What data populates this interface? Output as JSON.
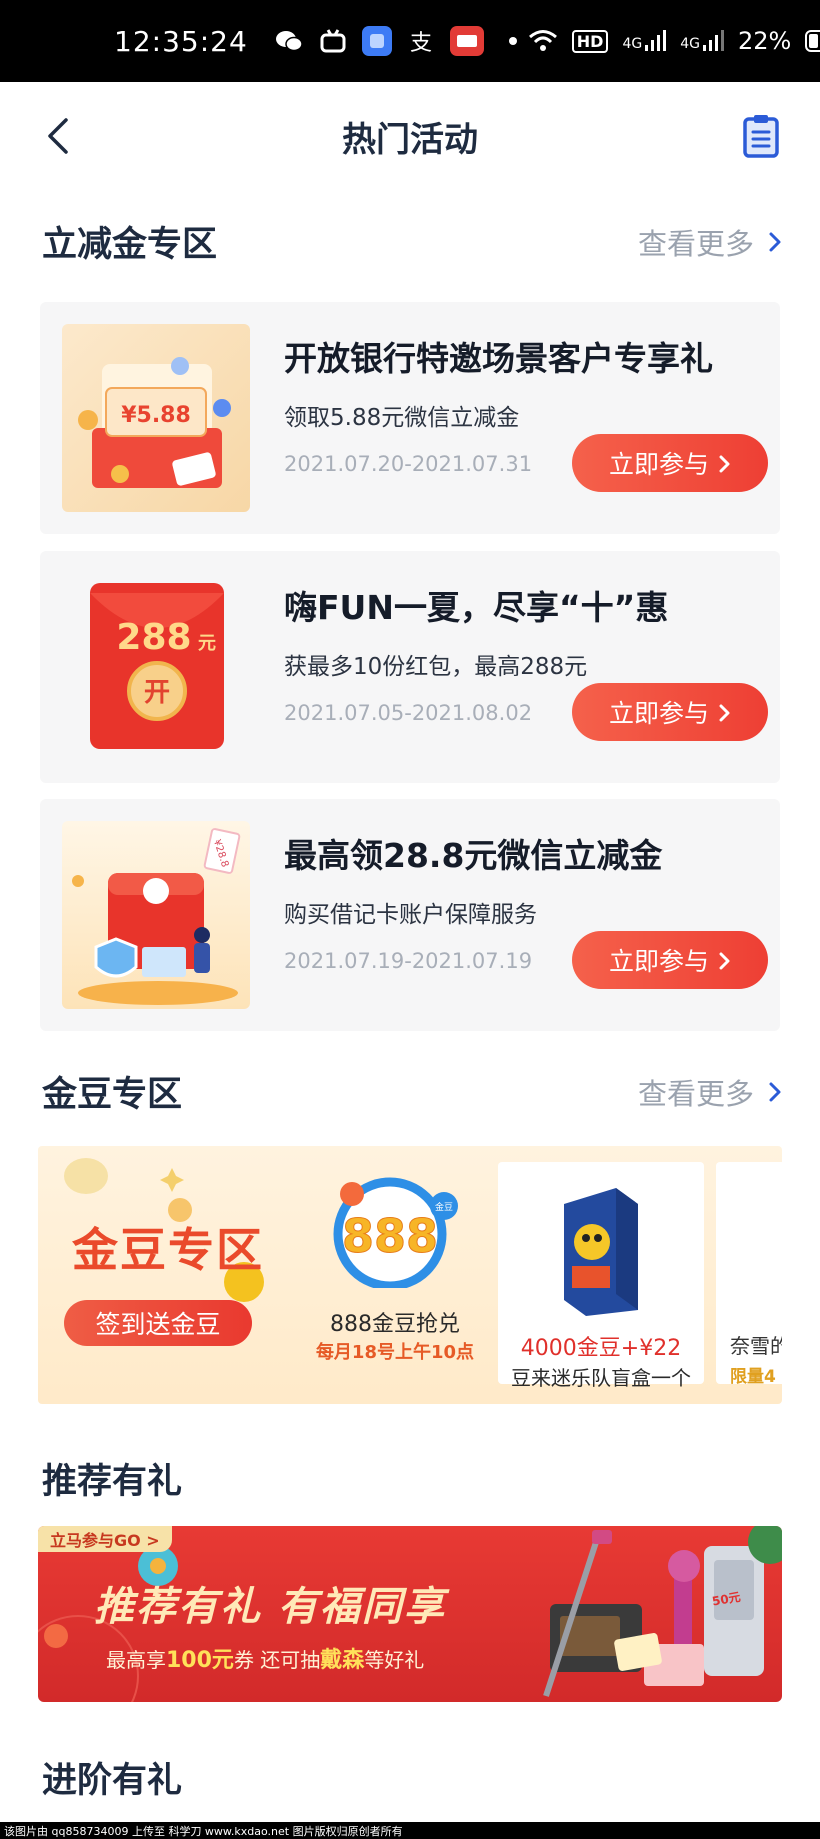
{
  "status_bar": {
    "time": "12:35:24",
    "battery": "22%",
    "network": "4G",
    "hd": "HD"
  },
  "header": {
    "title": "热门活动"
  },
  "section_discount": {
    "title": "立减金专区",
    "more": "查看更多"
  },
  "cards": [
    {
      "title": "开放银行特邀场景客户专享礼",
      "subtitle": "领取5.88元微信立减金",
      "date": "2021.07.20-2021.07.31",
      "button": "立即参与",
      "thumb_text": "¥5.88"
    },
    {
      "title": "嗨FUN一夏，尽享“十”惠",
      "subtitle": "获最多10份红包，最高288元",
      "date": "2021.07.05-2021.08.02",
      "button": "立即参与",
      "thumb_amount": "288",
      "thumb_unit": "元",
      "thumb_open": "开"
    },
    {
      "title": "最高领28.8元微信立减金",
      "subtitle": "购买借记卡账户保障服务",
      "date": "2021.07.19-2021.07.19",
      "button": "立即参与",
      "thumb_text": "¥28.8"
    }
  ],
  "section_beans": {
    "title": "金豆专区",
    "more": "查看更多"
  },
  "bean_banner": {
    "title": "金豆专区",
    "sign_button": "签到送金豆",
    "item1_label": "888金豆抢兑",
    "item1_time": "每月18号上午10点",
    "item1_logo": "888",
    "item1_logo_tag": "金豆",
    "item2_price": "4000金豆+¥22",
    "item2_name": "豆来迷乐队盲盒一个",
    "item3_price": "奈雪的",
    "item3_name": "限量4"
  },
  "section_referral": {
    "title": "推荐有礼"
  },
  "refer_banner": {
    "go_tag": "立马参与GO >",
    "title": "推荐有礼 有福同享",
    "sub_prefix": "最高享",
    "sub_amount": "100元",
    "sub_mid": "券 还可抽",
    "sub_brand": "戴森",
    "sub_suffix": "等好礼",
    "coupon_text": "50元"
  },
  "section_advanced": {
    "title": "进阶有礼"
  },
  "footer": {
    "text": "该图片由 qq858734009 上传至 科学刀 www.kxdao.net 图片版权归原创者所有"
  },
  "colors": {
    "accent": "#ef4a3b",
    "title": "#1e2b40",
    "muted": "#9aa2ae",
    "card_bg": "#f6f6f7",
    "link_icon": "#2b5bd7"
  }
}
